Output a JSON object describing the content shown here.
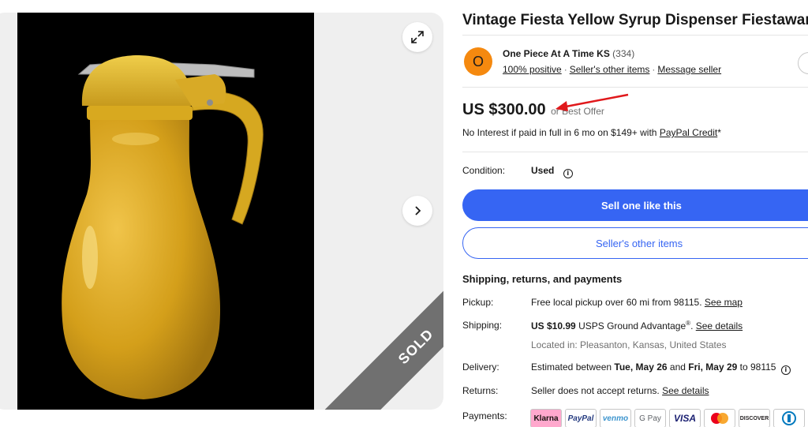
{
  "listing": {
    "title": "Vintage Fiesta Yellow Syrup Dispenser Fiestaware",
    "sold_label": "SOLD"
  },
  "seller": {
    "avatar_letter": "O",
    "name": "One Piece At A Time KS",
    "feedback_count": "(334)",
    "positive": "100% positive",
    "other_items": "Seller's other items",
    "message": "Message seller"
  },
  "price": {
    "amount": "US $300.00",
    "best_offer": "or Best Offer",
    "financing_text": "No Interest if paid in full in 6 mo on $149+ with",
    "financing_link": "PayPal Credit",
    "financing_suffix": "*"
  },
  "condition": {
    "label": "Condition:",
    "value": "Used"
  },
  "buttons": {
    "sell_one": "Sell one like this",
    "other_items": "Seller's other items"
  },
  "shipping": {
    "heading": "Shipping, returns, and payments",
    "pickup_label": "Pickup:",
    "pickup_value": "Free local pickup over 60 mi from 98115.",
    "pickup_link": "See map",
    "shipping_label": "Shipping:",
    "shipping_price": "US $10.99",
    "shipping_service": "USPS Ground Advantage",
    "shipping_reg": "®",
    "shipping_link": "See details",
    "location": "Located in: Pleasanton, Kansas, United States",
    "delivery_label": "Delivery:",
    "delivery_prefix": "Estimated between",
    "delivery_start": "Tue, May 26",
    "delivery_and": "and",
    "delivery_end": "Fri, May 29",
    "delivery_suffix": "to 98115",
    "returns_label": "Returns:",
    "returns_value": "Seller does not accept returns.",
    "returns_link": "See details",
    "payments_label": "Payments:"
  },
  "payment_methods": [
    "Klarna",
    "PayPal",
    "venmo",
    "G Pay",
    "VISA",
    "mastercard-icon",
    "DISCOVER",
    "diners-icon"
  ],
  "colors": {
    "accent_blue": "#3665f3",
    "avatar_orange": "#f5890f",
    "annotation_red": "#e0181b",
    "product_yellow": "#d9a81e"
  }
}
